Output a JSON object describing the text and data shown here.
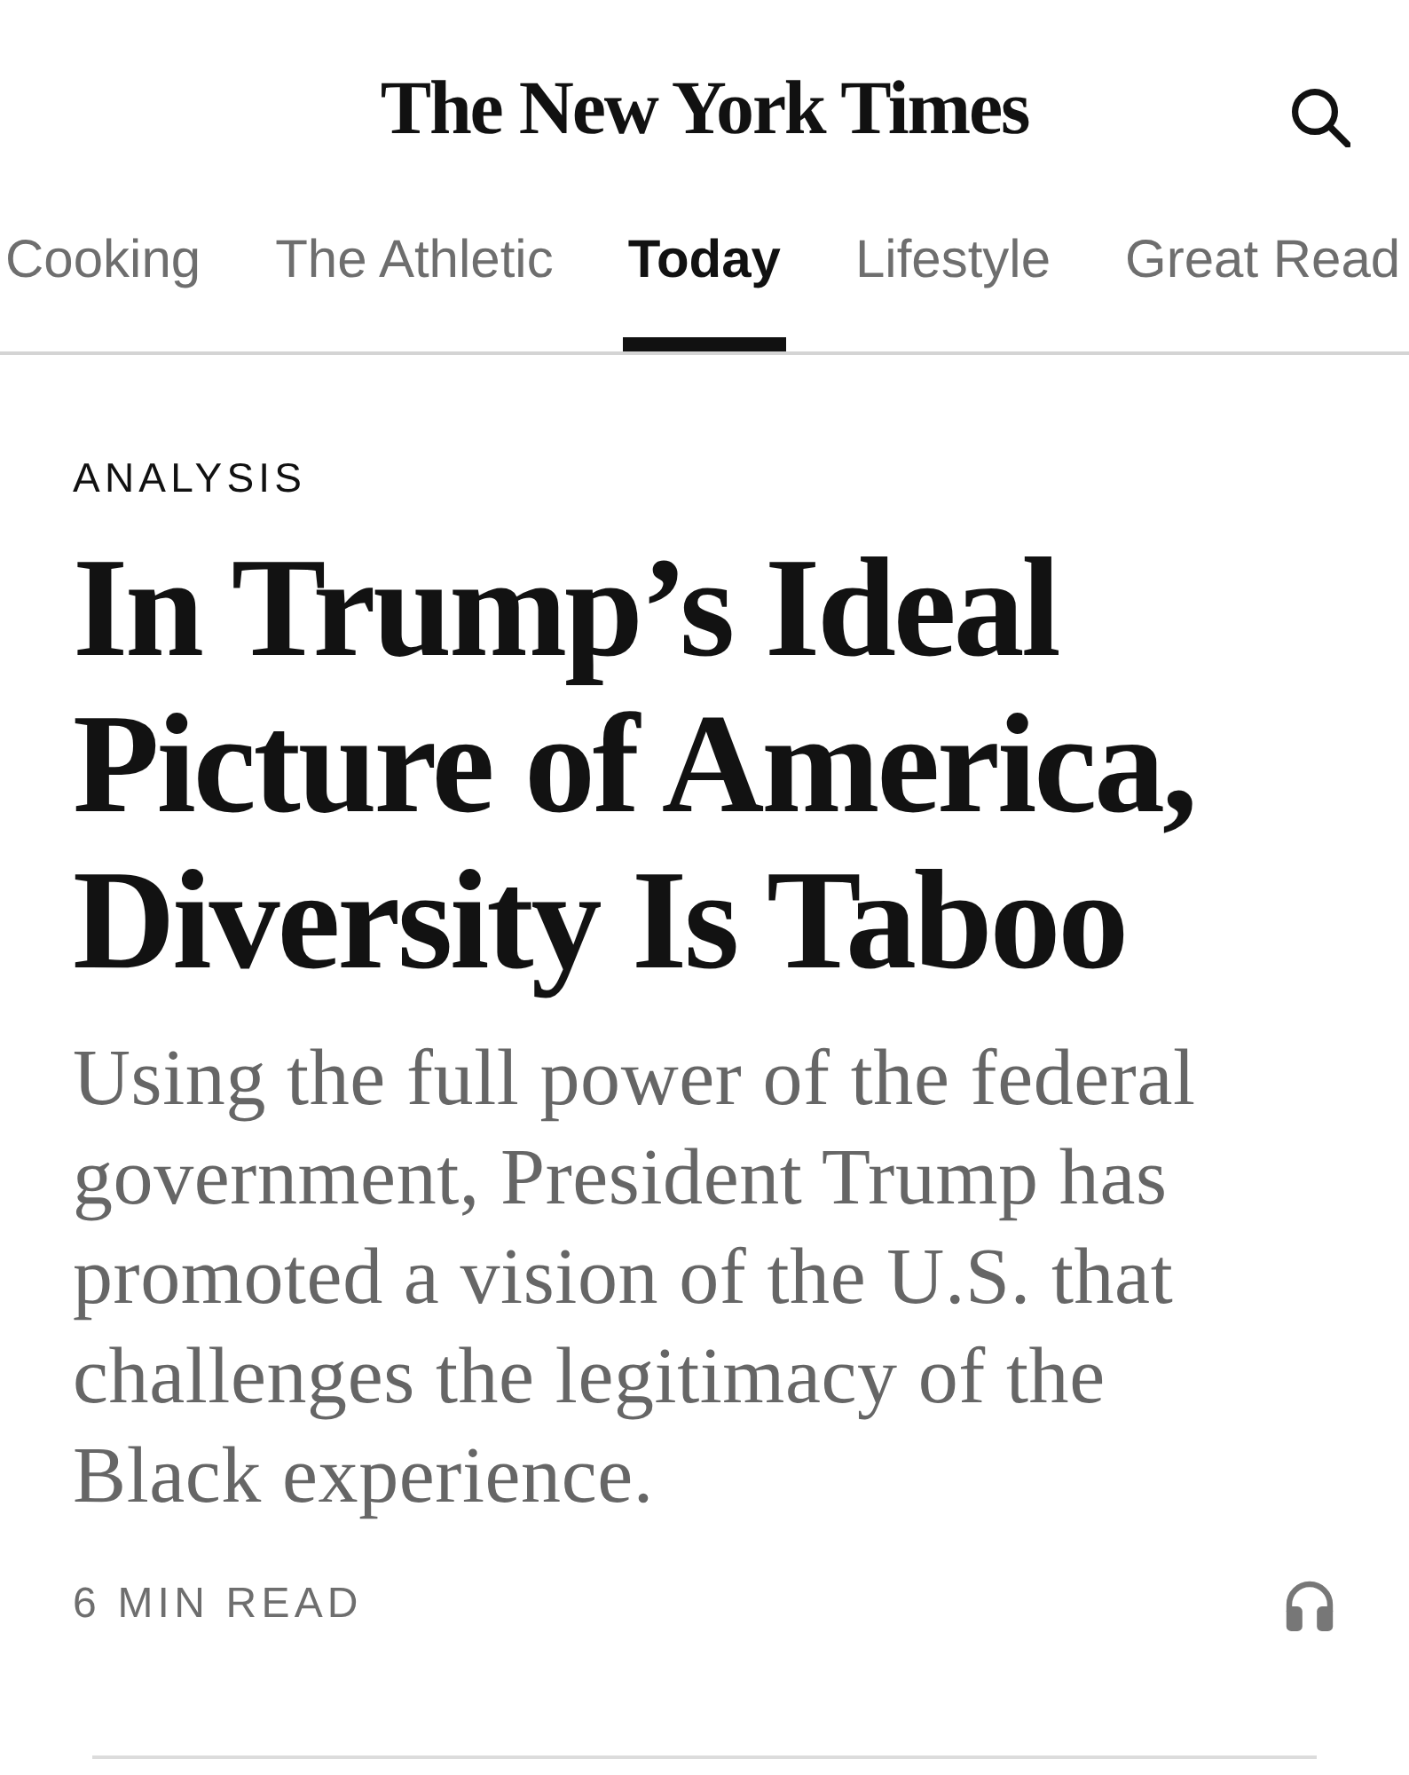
{
  "header": {
    "logo": "The New York Times"
  },
  "tabs": [
    {
      "label": "Cooking",
      "selected": false
    },
    {
      "label": "The Athletic",
      "selected": false
    },
    {
      "label": "Today",
      "selected": true
    },
    {
      "label": "Lifestyle",
      "selected": false
    },
    {
      "label": "Great Read",
      "selected": false
    }
  ],
  "article": {
    "kicker": "ANALYSIS",
    "headline": "In Trump’s Ideal Picture of America, Diversity Is Taboo",
    "summary": "Using the full power of the federal government, President Trump has promoted a vision of the U.S. that challenges the legitimacy of the Black experience.",
    "read_time": "6 MIN READ"
  }
}
